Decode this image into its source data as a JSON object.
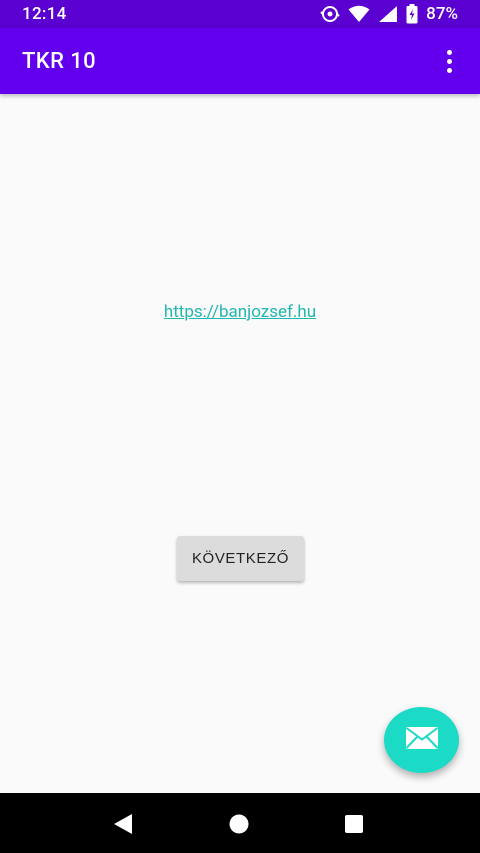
{
  "status_bar": {
    "time": "12:14",
    "battery_percent": "87%",
    "icons": [
      "sync-icon",
      "wifi-icon",
      "signal-icon",
      "battery-icon"
    ]
  },
  "app_bar": {
    "title": "TKR 10",
    "overflow_icon": "more-vert-icon"
  },
  "main": {
    "link_text": "https://banjozsef.hu",
    "next_button_label": "KÖVETKEZŐ",
    "fab_icon": "mail-icon"
  },
  "nav_bar": {
    "icons": [
      "back-icon",
      "home-icon",
      "recents-icon"
    ]
  },
  "colors": {
    "status_bar": "#5a00d0",
    "app_bar": "#6200ee",
    "link": "#21b6b0",
    "fab": "#1bdac6",
    "background": "#fafafa"
  }
}
